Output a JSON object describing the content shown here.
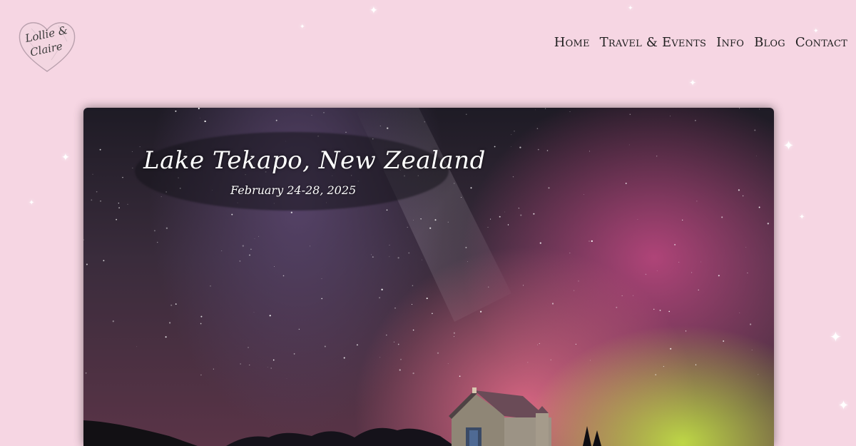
{
  "logo": {
    "line1": "Lollie &",
    "line2": "Claire",
    "icon": "heart-icon"
  },
  "nav": {
    "items": [
      {
        "label": "Home"
      },
      {
        "label": "Travel & Events"
      },
      {
        "label": "Info"
      },
      {
        "label": "Blog"
      },
      {
        "label": "Contact"
      }
    ]
  },
  "hero": {
    "title": "Lake Tekapo, New Zealand",
    "date": "February 24-28, 2025",
    "image": "aurora-church-photo"
  },
  "colors": {
    "background": "#f6d6e3",
    "nav_text": "#1f1f1f",
    "aurora_pink": "#e0607f",
    "aurora_green": "#c8e846"
  }
}
